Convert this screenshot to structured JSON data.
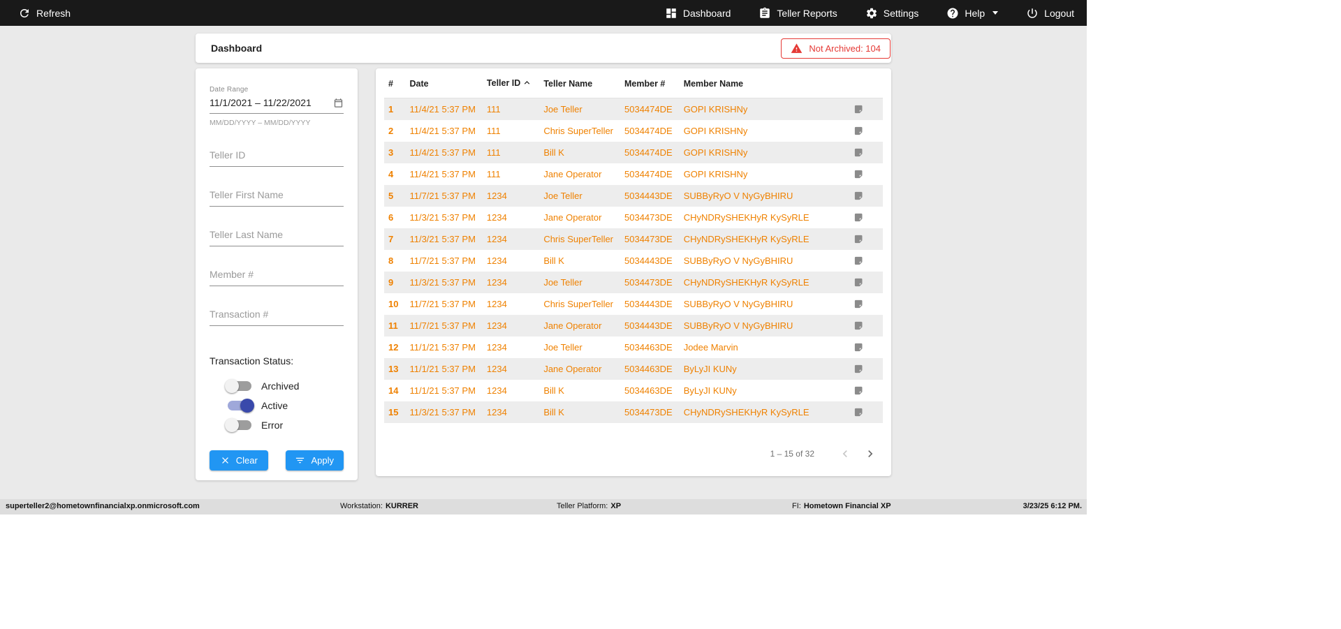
{
  "colors": {
    "topbar_bg": "#191919",
    "accent_blue": "#2196f3",
    "row_text_orange": "#ef8100",
    "alert_red": "#e53935",
    "toggle_on_blue": "#3949ab"
  },
  "topbar": {
    "refresh_label": "Refresh",
    "nav": [
      {
        "label": "Dashboard"
      },
      {
        "label": "Teller Reports"
      },
      {
        "label": "Settings"
      },
      {
        "label": "Help"
      },
      {
        "label": "Logout"
      }
    ]
  },
  "header": {
    "title": "Dashboard",
    "not_archived_badge": "Not Archived: 104"
  },
  "filters": {
    "date_range": {
      "label": "Date Range",
      "value": "11/1/2021 – 11/22/2021",
      "hint": "MM/DD/YYYY – MM/DD/YYYY"
    },
    "inputs": [
      {
        "placeholder": "Teller ID"
      },
      {
        "placeholder": "Teller First Name"
      },
      {
        "placeholder": "Teller Last Name"
      },
      {
        "placeholder": "Member #"
      },
      {
        "placeholder": "Transaction #"
      }
    ],
    "status_label": "Transaction Status:",
    "toggles": [
      {
        "label": "Archived",
        "state": "off"
      },
      {
        "label": "Active",
        "state": "on"
      },
      {
        "label": "Error",
        "state": "off"
      }
    ],
    "clear_label": "Clear",
    "apply_label": "Apply"
  },
  "table": {
    "columns": [
      "#",
      "Date",
      "Teller ID",
      "Teller Name",
      "Member #",
      "Member Name"
    ],
    "sorted_by": "Teller ID",
    "sort_direction": "asc",
    "rows": [
      {
        "num": "1",
        "date": "11/4/21 5:37 PM",
        "teller_id": "111",
        "teller_name": "Joe Teller",
        "member_num": "5034474DE",
        "member_name": "GOPI KRISHNy"
      },
      {
        "num": "2",
        "date": "11/4/21 5:37 PM",
        "teller_id": "111",
        "teller_name": "Chris SuperTeller",
        "member_num": "5034474DE",
        "member_name": "GOPI KRISHNy"
      },
      {
        "num": "3",
        "date": "11/4/21 5:37 PM",
        "teller_id": "111",
        "teller_name": "Bill K",
        "member_num": "5034474DE",
        "member_name": "GOPI KRISHNy"
      },
      {
        "num": "4",
        "date": "11/4/21 5:37 PM",
        "teller_id": "111",
        "teller_name": "Jane Operator",
        "member_num": "5034474DE",
        "member_name": "GOPI KRISHNy"
      },
      {
        "num": "5",
        "date": "11/7/21 5:37 PM",
        "teller_id": "1234",
        "teller_name": "Joe Teller",
        "member_num": "5034443DE",
        "member_name": "SUBByRyO V NyGyBHIRU"
      },
      {
        "num": "6",
        "date": "11/3/21 5:37 PM",
        "teller_id": "1234",
        "teller_name": "Jane Operator",
        "member_num": "5034473DE",
        "member_name": "CHyNDRySHEKHyR KySyRLE"
      },
      {
        "num": "7",
        "date": "11/3/21 5:37 PM",
        "teller_id": "1234",
        "teller_name": "Chris SuperTeller",
        "member_num": "5034473DE",
        "member_name": "CHyNDRySHEKHyR KySyRLE"
      },
      {
        "num": "8",
        "date": "11/7/21 5:37 PM",
        "teller_id": "1234",
        "teller_name": "Bill K",
        "member_num": "5034443DE",
        "member_name": "SUBByRyO V NyGyBHIRU"
      },
      {
        "num": "9",
        "date": "11/3/21 5:37 PM",
        "teller_id": "1234",
        "teller_name": "Joe Teller",
        "member_num": "5034473DE",
        "member_name": "CHyNDRySHEKHyR KySyRLE"
      },
      {
        "num": "10",
        "date": "11/7/21 5:37 PM",
        "teller_id": "1234",
        "teller_name": "Chris SuperTeller",
        "member_num": "5034443DE",
        "member_name": "SUBByRyO V NyGyBHIRU"
      },
      {
        "num": "11",
        "date": "11/7/21 5:37 PM",
        "teller_id": "1234",
        "teller_name": "Jane Operator",
        "member_num": "5034443DE",
        "member_name": "SUBByRyO V NyGyBHIRU"
      },
      {
        "num": "12",
        "date": "11/1/21 5:37 PM",
        "teller_id": "1234",
        "teller_name": "Joe Teller",
        "member_num": "5034463DE",
        "member_name": "Jodee Marvin"
      },
      {
        "num": "13",
        "date": "11/1/21 5:37 PM",
        "teller_id": "1234",
        "teller_name": "Jane Operator",
        "member_num": "5034463DE",
        "member_name": "ByLyJI KUNy"
      },
      {
        "num": "14",
        "date": "11/1/21 5:37 PM",
        "teller_id": "1234",
        "teller_name": "Bill K",
        "member_num": "5034463DE",
        "member_name": "ByLyJI KUNy"
      },
      {
        "num": "15",
        "date": "11/3/21 5:37 PM",
        "teller_id": "1234",
        "teller_name": "Bill K",
        "member_num": "5034473DE",
        "member_name": "CHyNDRySHEKHyR KySyRLE"
      }
    ],
    "pagination": "1 – 15 of 32"
  },
  "footer": {
    "email": "superteller2@hometownfinancialxp.onmicrosoft.com",
    "workstation_label": "Workstation:",
    "workstation": "KURRER",
    "platform_label": "Teller Platform:",
    "platform": "XP",
    "fi_label": "FI:",
    "fi": "Hometown Financial XP",
    "datetime": "3/23/25 6:12 PM."
  }
}
